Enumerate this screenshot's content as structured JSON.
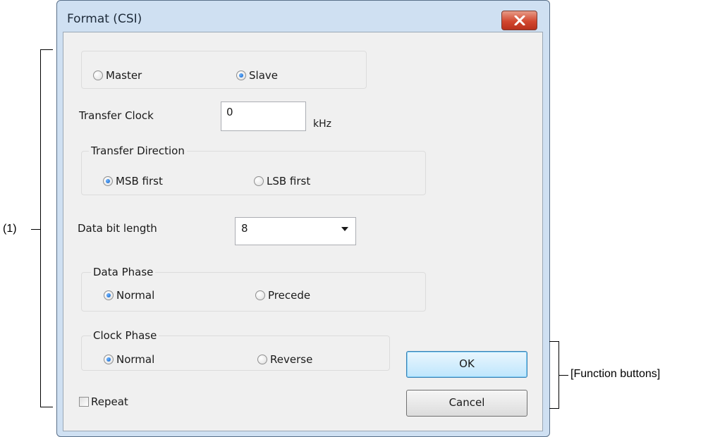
{
  "window": {
    "title": "Format (CSI)"
  },
  "mode": {
    "options": [
      "Master",
      "Slave"
    ],
    "selected": "Slave"
  },
  "transfer_clock": {
    "label": "Transfer Clock",
    "value": "0",
    "unit": "kHz"
  },
  "transfer_direction": {
    "legend": "Transfer Direction",
    "options": [
      "MSB first",
      "LSB first"
    ],
    "selected": "MSB first"
  },
  "data_bit_length": {
    "label": "Data bit length",
    "value": "8"
  },
  "data_phase": {
    "legend": "Data Phase",
    "options": [
      "Normal",
      "Precede"
    ],
    "selected": "Normal"
  },
  "clock_phase": {
    "legend": "Clock Phase",
    "options": [
      "Normal",
      "Reverse"
    ],
    "selected": "Normal"
  },
  "repeat": {
    "label": "Repeat",
    "checked": false
  },
  "buttons": {
    "ok": "OK",
    "cancel": "Cancel"
  },
  "annotations": {
    "area1": "(1)",
    "function_buttons": "[Function buttons]"
  },
  "colors": {
    "title_bar": "#cfe0f2",
    "client": "#f0f0f0",
    "close_button": "#d2472f",
    "default_button": "#bee6fd"
  }
}
